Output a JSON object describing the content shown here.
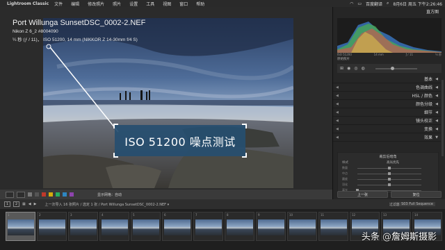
{
  "menubar": {
    "apple": "",
    "app_name": "Lightroom Classic",
    "menus": [
      "文件",
      "编辑",
      "修改照片",
      "照片",
      "设置",
      "工具",
      "视图",
      "窗口",
      "帮助"
    ],
    "status_items": [
      "百度翻译",
      "8月6日 周五 下午2:26:46"
    ]
  },
  "overlay": {
    "filename": "Port Willunga SunsetDSC_0002-2.NEF",
    "camera": "Nikon Z 6_2 #8004090",
    "exposure": "¼ 秒 (ƒ / 11)，  ISO 51200, 14 mm (NIKKOR Z 14-30mm f/4 S)"
  },
  "callout": {
    "text": "ISO 51200 噪点测试"
  },
  "toolbar": {
    "zoom_text": "显示网格：自动"
  },
  "right_panel": {
    "histogram_label": "直方图",
    "hist_info": [
      "ISO 51200",
      "14 mm",
      "ƒ / 11",
      "¼ 秒"
    ],
    "original_photo": "原始照片",
    "sections": [
      {
        "label": "基本",
        "triangle": "◀"
      },
      {
        "label": "色调曲线",
        "triangle": "◀"
      },
      {
        "label": "HSL / 颜色",
        "triangle": "◀"
      },
      {
        "label": "颜色分级",
        "triangle": "◀"
      },
      {
        "label": "细节",
        "triangle": "◀"
      },
      {
        "label": "镜头校正",
        "triangle": "◀"
      },
      {
        "label": "变换",
        "triangle": "◀"
      },
      {
        "label": "效果",
        "triangle": "▼"
      }
    ],
    "detail": {
      "title": "裁剪后暗角",
      "style_label": "样式",
      "style_value": "高光优先",
      "sliders": [
        {
          "label": "数量",
          "value": 0.5
        },
        {
          "label": "中点",
          "value": 0.5
        },
        {
          "label": "圆度",
          "value": 0.5
        },
        {
          "label": "羽化",
          "value": 0.5
        },
        {
          "label": "高光",
          "value": 0.0
        }
      ]
    },
    "buttons": {
      "previous": "上一张",
      "reset": "复位"
    }
  },
  "filmstrip_bar": {
    "monitor1": "1",
    "monitor2": "2",
    "path": "上一次导入  16 张照片 / 选定 1 张 / Port Willunga SunsetDSC_0002-2.NEF ▾",
    "filter_label": "过滤器：",
    "filter_value": "S03 Full Sequence"
  },
  "filmstrip": {
    "numbers": [
      "1",
      "2",
      "3",
      "4",
      "5",
      "6",
      "7",
      "8",
      "9",
      "10",
      "11",
      "12",
      "13",
      "14"
    ]
  },
  "watermark": {
    "prefix": "头条",
    "at": "@",
    "name": "詹姆斯摄影"
  },
  "colors": {
    "accent": "#26506f",
    "panel": "#262626",
    "background": "#1b1b1b"
  }
}
